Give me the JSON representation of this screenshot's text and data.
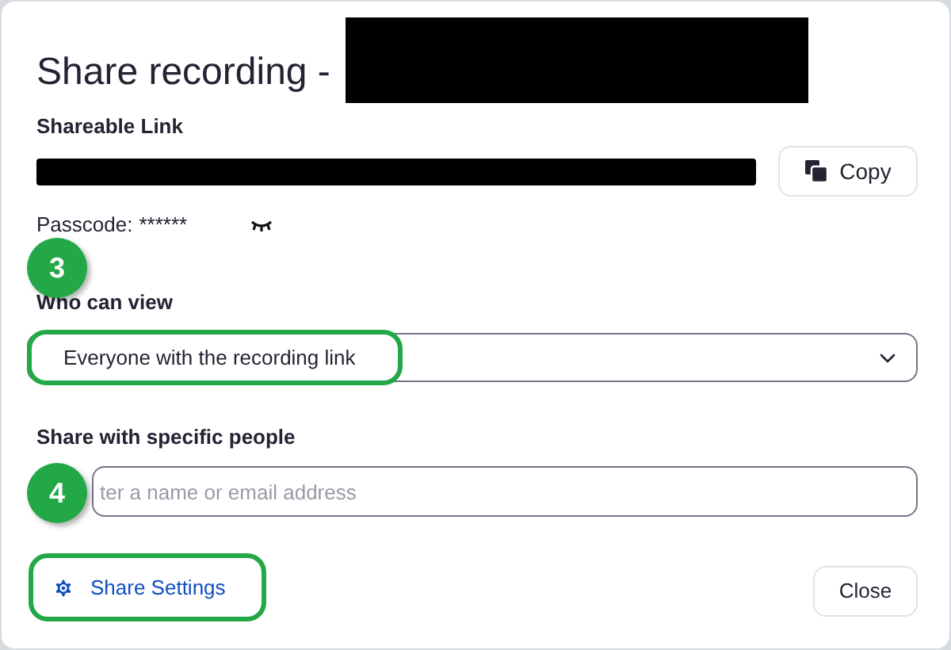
{
  "dialog": {
    "title": "Share recording -"
  },
  "shareable_link": {
    "label": "Shareable Link",
    "copy_button": "Copy"
  },
  "passcode": {
    "label": "Passcode:",
    "value": "******",
    "visible": false
  },
  "who_can_view": {
    "label": "Who can view",
    "value": "Everyone with the recording link",
    "highlighted": true
  },
  "share_with": {
    "label": "Share with specific people",
    "placeholder": "ter a name or email address"
  },
  "share_settings": {
    "label": "Share Settings",
    "highlighted": true
  },
  "close_button": "Close",
  "annotations": [
    {
      "label": "3"
    },
    {
      "label": "4"
    }
  ]
}
